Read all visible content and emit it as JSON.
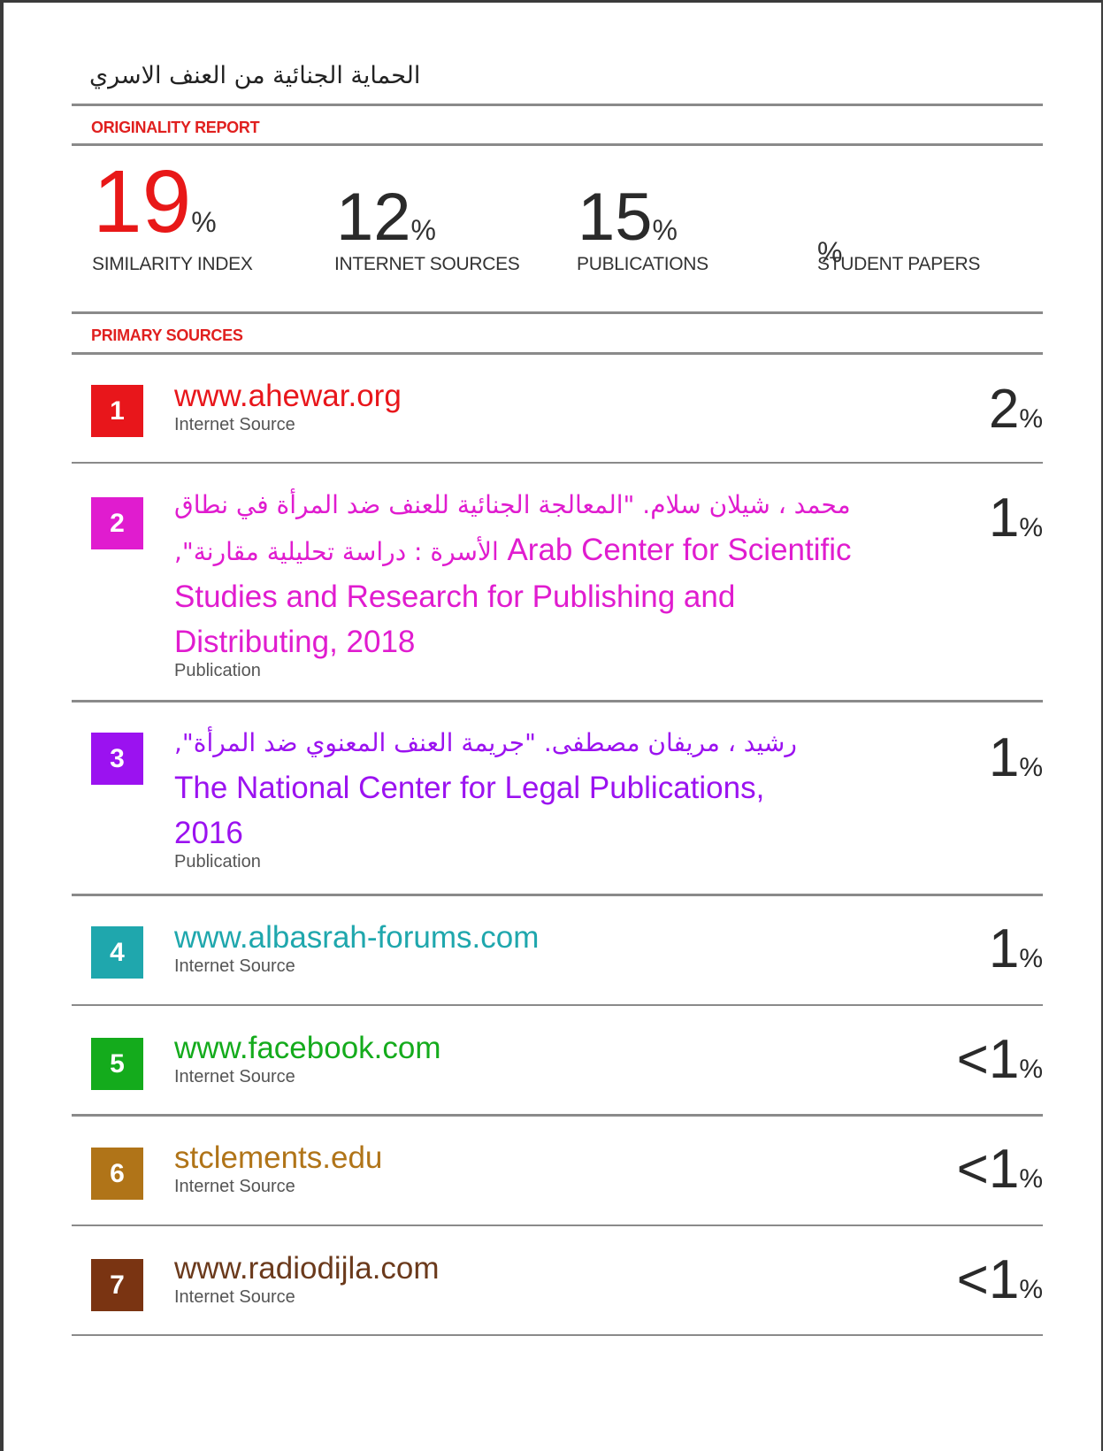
{
  "document": {
    "title": "الحماية الجنائية من العنف الاسري",
    "originality_label": "ORIGINALITY REPORT",
    "primary_sources_label": "PRIMARY SOURCES"
  },
  "stats": [
    {
      "value": "19",
      "unit": "%",
      "label": "SIMILARITY INDEX",
      "color": "#e81818"
    },
    {
      "value": "12",
      "unit": "%",
      "label": "INTERNET SOURCES"
    },
    {
      "value": "15",
      "unit": "%",
      "label": "PUBLICATIONS"
    },
    {
      "value": "",
      "unit": "%",
      "label": "STUDENT PAPERS"
    }
  ],
  "sources": [
    {
      "rank": "1",
      "color": "#e8161b",
      "title": "www.ahewar.org",
      "type": "Internet Source",
      "prefix": "",
      "percent": "2",
      "unit": "%"
    },
    {
      "rank": "2",
      "color": "#e01ccf",
      "title_arabic_1": "محمد ، شيلان سلام. \"المعالجة الجنائية للعنف ضد المرأة في نطاق",
      "title_arabic_2": "الأسرة : دراسة تحليلية مقارنة\",",
      "title_en_1": " Arab Center for Scientific",
      "title_en_2": "Studies and Research for Publishing and",
      "title_en_3": "Distributing, 2018",
      "type": "Publication",
      "prefix": "",
      "percent": "1",
      "unit": "%"
    },
    {
      "rank": "3",
      "color": "#9b12f0",
      "title_arabic_1": "رشيد ، مريفان مصطفى. \"جريمة العنف المعنوي ضد المرأة\",",
      "title_en_1": "The National Center for Legal Publications,",
      "title_en_2": "2016",
      "type": "Publication",
      "prefix": "",
      "percent": "1",
      "unit": "%"
    },
    {
      "rank": "4",
      "color": "#1fa7ad",
      "title": "www.albasrah-forums.com",
      "type": "Internet Source",
      "prefix": "",
      "percent": "1",
      "unit": "%"
    },
    {
      "rank": "5",
      "color": "#14ab1c",
      "title": "www.facebook.com",
      "type": "Internet Source",
      "prefix": "<",
      "percent": "1",
      "unit": "%"
    },
    {
      "rank": "6",
      "color": "#b07418",
      "title": "stclements.edu",
      "type": "Internet Source",
      "prefix": "<",
      "percent": "1",
      "unit": "%"
    },
    {
      "rank": "7",
      "color": "#7a3412",
      "title": "www.radiodijla.com",
      "type": "Internet Source",
      "prefix": "<",
      "percent": "1",
      "unit": "%"
    }
  ]
}
